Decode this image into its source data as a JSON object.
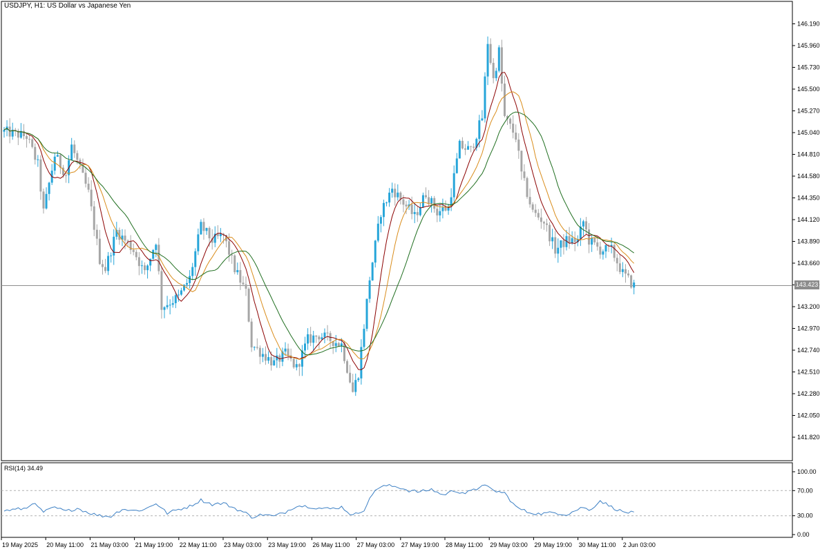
{
  "chart_data": [
    {
      "type": "candlestick",
      "title": "USDJPY, H1:  US Dollar vs Japanese Yen",
      "symbol": "USDJPY",
      "timeframe": "H1",
      "ylim": [
        141.6,
        146.3
      ],
      "y_ticks": [
        "146.190",
        "145.960",
        "145.730",
        "145.500",
        "145.270",
        "145.040",
        "144.810",
        "144.580",
        "144.350",
        "144.120",
        "143.890",
        "143.660",
        "143.430",
        "143.200",
        "142.970",
        "142.740",
        "142.510",
        "142.280",
        "142.050",
        "141.820"
      ],
      "current_price": "143.423",
      "x_tick_labels": [
        "19 May 2025",
        "20 May 11:00",
        "21 May 03:00",
        "21 May 19:00",
        "22 May 11:00",
        "23 May 03:00",
        "23 May 19:00",
        "26 May 11:00",
        "27 May 03:00",
        "27 May 19:00",
        "28 May 11:00",
        "29 May 03:00",
        "29 May 19:00",
        "30 May 11:00",
        "2 Jun 03:00"
      ],
      "bull_color": "#26a5d9",
      "bear_color": "#a6a6a6",
      "ma_colors": [
        "#8b0000",
        "#d98c1a",
        "#1f6e1f"
      ],
      "anchors": [
        [
          0,
          145.05
        ],
        [
          8,
          145.0
        ],
        [
          12,
          144.7
        ],
        [
          14,
          144.2
        ],
        [
          18,
          144.8
        ],
        [
          22,
          144.6
        ],
        [
          24,
          144.9
        ],
        [
          30,
          144.4
        ],
        [
          34,
          143.7
        ],
        [
          36,
          143.6
        ],
        [
          40,
          144.0
        ],
        [
          46,
          143.8
        ],
        [
          50,
          143.55
        ],
        [
          54,
          143.9
        ],
        [
          56,
          143.2
        ],
        [
          62,
          143.3
        ],
        [
          66,
          143.5
        ],
        [
          70,
          144.05
        ],
        [
          74,
          143.9
        ],
        [
          78,
          143.95
        ],
        [
          82,
          143.6
        ],
        [
          86,
          143.35
        ],
        [
          88,
          142.8
        ],
        [
          92,
          142.7
        ],
        [
          96,
          142.6
        ],
        [
          100,
          142.7
        ],
        [
          104,
          142.55
        ],
        [
          108,
          142.85
        ],
        [
          112,
          142.9
        ],
        [
          116,
          142.85
        ],
        [
          120,
          142.8
        ],
        [
          124,
          142.3
        ],
        [
          126,
          142.5
        ],
        [
          130,
          143.5
        ],
        [
          134,
          144.2
        ],
        [
          138,
          144.45
        ],
        [
          142,
          144.3
        ],
        [
          146,
          144.15
        ],
        [
          150,
          144.4
        ],
        [
          154,
          144.2
        ],
        [
          158,
          144.25
        ],
        [
          162,
          144.9
        ],
        [
          166,
          144.85
        ],
        [
          170,
          145.2
        ],
        [
          172,
          146.0
        ],
        [
          174,
          145.6
        ],
        [
          176,
          145.9
        ],
        [
          178,
          145.2
        ],
        [
          182,
          145.0
        ],
        [
          184,
          144.6
        ],
        [
          188,
          144.2
        ],
        [
          192,
          144.1
        ],
        [
          196,
          143.8
        ],
        [
          200,
          143.9
        ],
        [
          204,
          143.9
        ],
        [
          206,
          144.1
        ],
        [
          208,
          143.9
        ],
        [
          212,
          143.8
        ],
        [
          216,
          143.8
        ],
        [
          220,
          143.55
        ],
        [
          224,
          143.42
        ]
      ]
    },
    {
      "type": "line",
      "title": "RSI(14) 34.49",
      "ylim": [
        0,
        100
      ],
      "y_ticks": [
        "100.00",
        "70.00",
        "30.00",
        "0.00"
      ],
      "levels": [
        70,
        30
      ],
      "line_color": "#3b7fc4",
      "anchors": [
        [
          0,
          38
        ],
        [
          8,
          42
        ],
        [
          10,
          51
        ],
        [
          14,
          36
        ],
        [
          18,
          43
        ],
        [
          22,
          37
        ],
        [
          26,
          42
        ],
        [
          30,
          35
        ],
        [
          34,
          30
        ],
        [
          38,
          29
        ],
        [
          42,
          41
        ],
        [
          46,
          38
        ],
        [
          50,
          40
        ],
        [
          54,
          50
        ],
        [
          58,
          34
        ],
        [
          62,
          40
        ],
        [
          66,
          45
        ],
        [
          70,
          55
        ],
        [
          74,
          48
        ],
        [
          78,
          50
        ],
        [
          82,
          42
        ],
        [
          86,
          34
        ],
        [
          88,
          28
        ],
        [
          92,
          32
        ],
        [
          96,
          29
        ],
        [
          100,
          36
        ],
        [
          104,
          46
        ],
        [
          108,
          45
        ],
        [
          112,
          42
        ],
        [
          116,
          41
        ],
        [
          120,
          44
        ],
        [
          124,
          30
        ],
        [
          128,
          40
        ],
        [
          132,
          72
        ],
        [
          136,
          78
        ],
        [
          140,
          76
        ],
        [
          144,
          70
        ],
        [
          148,
          68
        ],
        [
          152,
          72
        ],
        [
          156,
          63
        ],
        [
          160,
          70
        ],
        [
          164,
          66
        ],
        [
          168,
          72
        ],
        [
          170,
          80
        ],
        [
          174,
          70
        ],
        [
          178,
          66
        ],
        [
          182,
          44
        ],
        [
          186,
          36
        ],
        [
          190,
          33
        ],
        [
          196,
          35
        ],
        [
          200,
          32
        ],
        [
          206,
          44
        ],
        [
          208,
          38
        ],
        [
          212,
          54
        ],
        [
          216,
          44
        ],
        [
          220,
          36
        ],
        [
          224,
          34.49
        ]
      ]
    }
  ]
}
